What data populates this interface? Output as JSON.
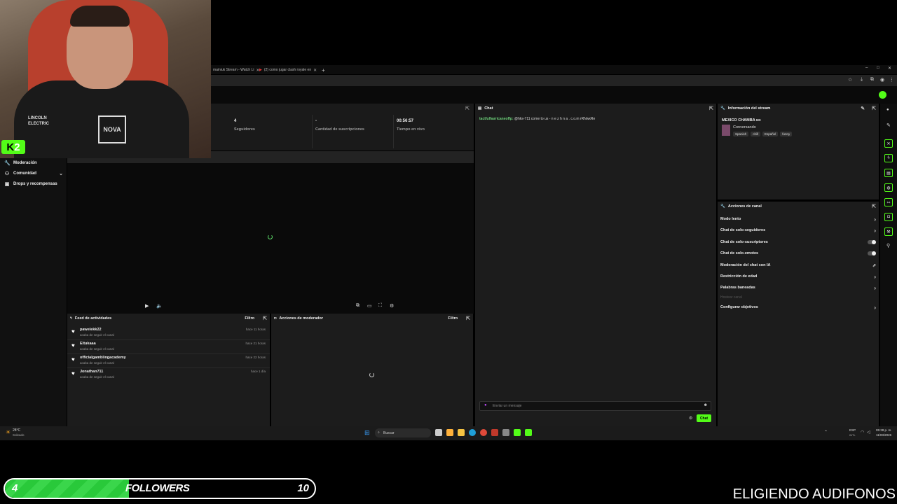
{
  "browser": {
    "tabs": [
      {
        "label": "mainiuk Stream - Watch Li"
      },
      {
        "label": "(2) como jugar clash royale en"
      }
    ],
    "new_tab": "+",
    "window_controls": [
      "–",
      "□",
      "✕"
    ]
  },
  "sidebar": {
    "items": [
      {
        "label": "Moderación",
        "icon": "wrench-icon"
      },
      {
        "label": "Comunidad",
        "icon": "community-icon",
        "has_chevron": true
      },
      {
        "label": "Drops y recompensas",
        "icon": "gift-icon"
      }
    ]
  },
  "stats": [
    {
      "value": "4",
      "label": "Seguidores"
    },
    {
      "value": "-",
      "label": "Cantidad de suscripciones"
    },
    {
      "value": "00:56:57",
      "label": "Tiempo en vivo"
    }
  ],
  "activity_feed": {
    "title": "Feed de actividades",
    "filter": "Filtro",
    "items": [
      {
        "name": "pawelekk22",
        "action": "acaba de seguir el canal",
        "time": "hace 11 horas"
      },
      {
        "name": "Eltukaaa",
        "action": "acaba de seguir el canal",
        "time": "hace 21 horas"
      },
      {
        "name": "officialgamblingacademy",
        "action": "acaba de seguir el canal",
        "time": "hace 22 horas"
      },
      {
        "name": "Jonathan711",
        "action": "acaba de seguir el canal",
        "time": "hace 1 día"
      }
    ]
  },
  "mod_actions": {
    "title": "Acciones de moderador",
    "filter": "Filtro"
  },
  "chat": {
    "title": "Chat",
    "message_user": "tactfulharricaneoffp:",
    "message_text": "@hks-711 come to us - n e z h n a . c.o.m rRNwxRe",
    "input_placeholder": "Enviar un mensaje",
    "send_label": "Chat"
  },
  "stream_info": {
    "title": "Información del stream",
    "stream_title": "MEXICO CHAMBA",
    "flag": "MX",
    "category": "Conversando",
    "tags": [
      "Spanish",
      "chill",
      "Español",
      "funny"
    ]
  },
  "channel_actions": {
    "title": "Acciones de canal",
    "items": [
      {
        "label": "Modo lento",
        "control": "chevron"
      },
      {
        "label": "Chat de solo-seguidores",
        "control": "chevron"
      },
      {
        "label": "Chat de solo-suscriptores",
        "control": "toggle"
      },
      {
        "label": "Chat de solo-emotes",
        "control": "toggle"
      },
      {
        "label": "Moderación del chat con IA",
        "control": "chart"
      },
      {
        "label": "Restricción de edad",
        "control": "chevron"
      },
      {
        "label": "Palabras baneadas",
        "control": "chevron"
      },
      {
        "label": "Hostear canal",
        "control": "none",
        "disabled": true
      },
      {
        "label": "Configurar objetivos",
        "control": "chevron"
      }
    ]
  },
  "taskbar": {
    "weather_temp": "28°C",
    "weather_desc": "Soleado",
    "search_placeholder": "Buscar",
    "language": "ESP",
    "language_sub": "INTL",
    "time": "05:38 p. m.",
    "date": "11/03/2026"
  },
  "webcam": {
    "badge": "2",
    "shirt_text": "LINCOLN ELECTRIC",
    "shirt_logo": "NOVA"
  },
  "followers_goal": {
    "current": "4",
    "label": "FOLLOWERS",
    "goal": "10",
    "progress_fraction": 0.4
  },
  "overlay_text": "ELIGIENDO AUDIFONOS",
  "colors": {
    "brand_green": "#53fc18",
    "panel_bg": "#1c1c1c",
    "background": "#000000"
  }
}
